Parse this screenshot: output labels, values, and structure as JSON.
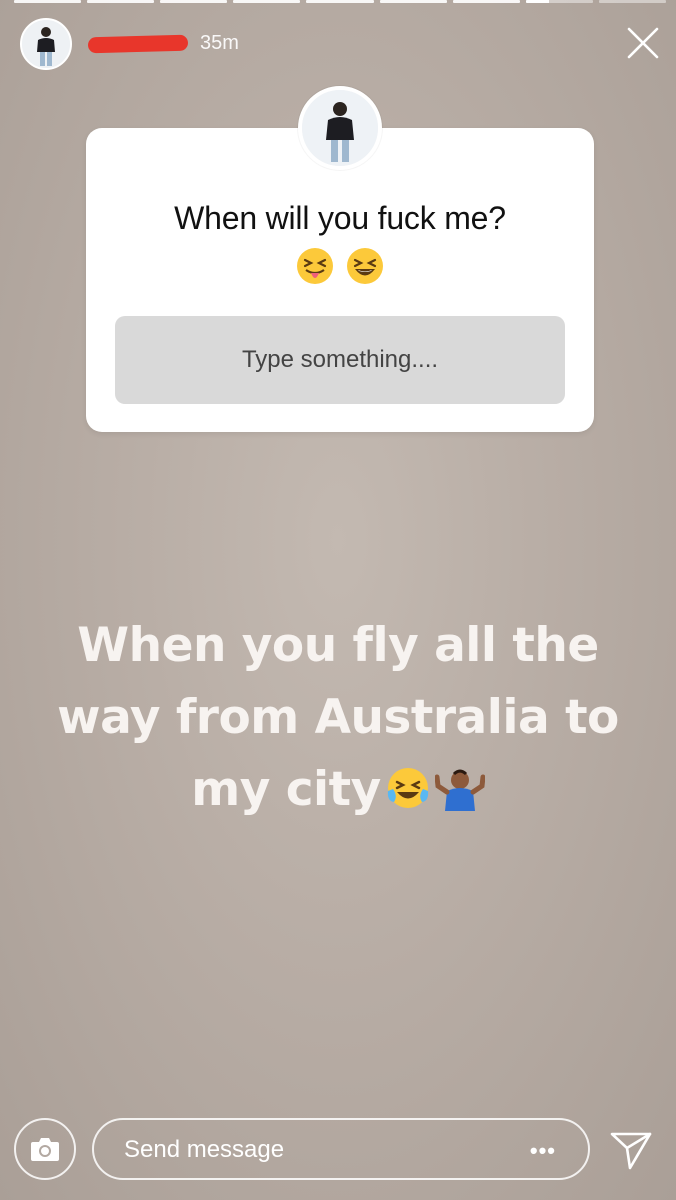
{
  "story": {
    "segments_total": 9,
    "segments_completed": 7,
    "current_segment_progress": 0.35,
    "timestamp": "35m"
  },
  "sticker": {
    "question": "When will you fuck me?",
    "emojis": [
      "😝",
      "😆"
    ],
    "answer_placeholder": "Type something...."
  },
  "caption": {
    "line1": "When you fly all the",
    "line2": "way from Australia to",
    "line3": "my city",
    "emojis": [
      "😂",
      "🤷🏾‍♂️"
    ]
  },
  "bottom": {
    "message_placeholder": "Send message",
    "more_label": "•••"
  },
  "icons": {
    "close": "close-icon",
    "camera": "camera-icon",
    "send": "send-icon"
  },
  "colors": {
    "redaction": "#e8362b",
    "sticker_bg": "#ffffff",
    "answer_box": "#d9d9d9",
    "caption_text": "#f7f3f0"
  }
}
